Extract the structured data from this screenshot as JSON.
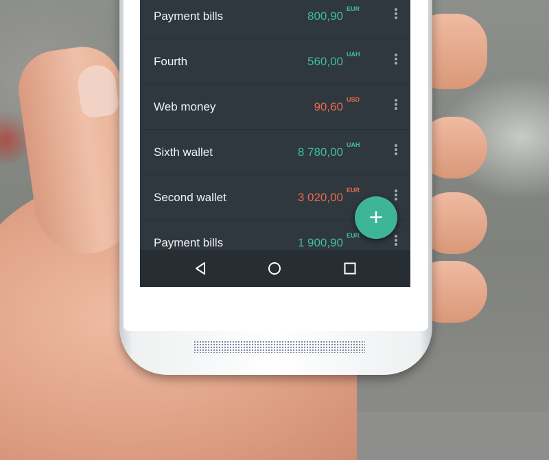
{
  "wallets": [
    {
      "name": "Payment bills",
      "amount": "800,90",
      "currency": "EUR",
      "trend": "positive"
    },
    {
      "name": "Fourth",
      "amount": "560,00",
      "currency": "UAH",
      "trend": "positive"
    },
    {
      "name": "Web money",
      "amount": "90,60",
      "currency": "USD",
      "trend": "negative"
    },
    {
      "name": "Sixth wallet",
      "amount": "8 780,00",
      "currency": "UAH",
      "trend": "positive"
    },
    {
      "name": "Second wallet",
      "amount": "3 020,00",
      "currency": "EUR",
      "trend": "negative"
    },
    {
      "name": "Payment bills",
      "amount": "1 900,90",
      "currency": "EUR",
      "trend": "positive"
    }
  ],
  "fab": {
    "symbol": "+",
    "icon": "plus-icon"
  },
  "navbar": {
    "icons": [
      "back-triangle-icon",
      "home-circle-icon",
      "recent-square-icon"
    ]
  },
  "hardware": {
    "back_icon": "hardware-back-icon",
    "home_icon": "hardware-home-icon"
  },
  "colors": {
    "positive": "#3fbf98",
    "negative": "#ec6b4a",
    "background": "#2f373f",
    "fab": "#3eb597"
  }
}
